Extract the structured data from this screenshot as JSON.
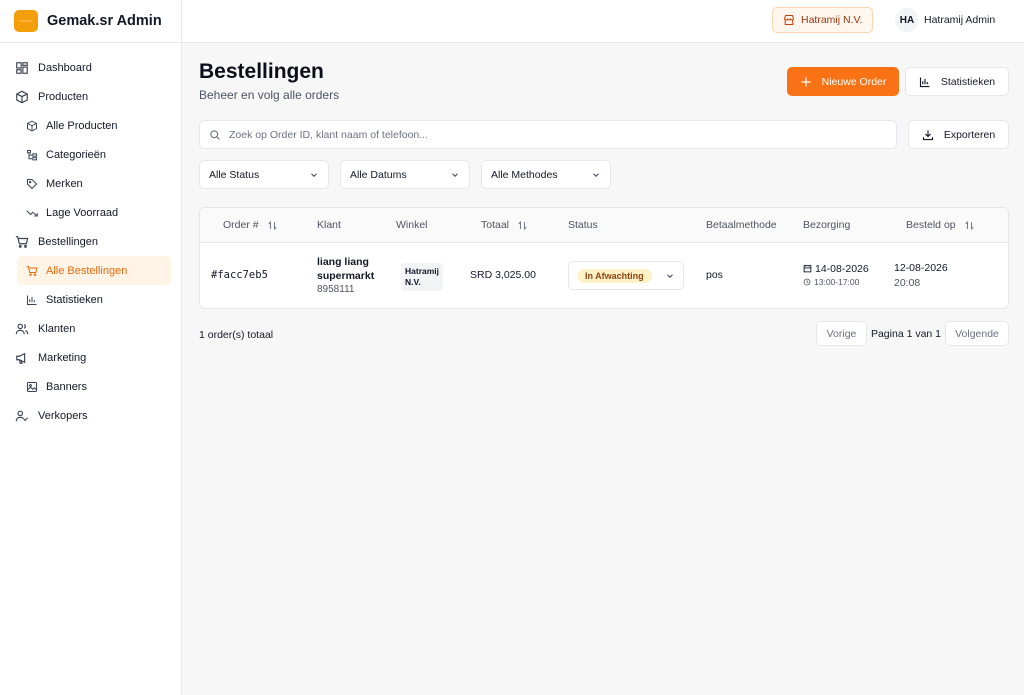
{
  "app": {
    "title": "Gemak.sr Admin"
  },
  "sidebar": {
    "items": [
      {
        "label": "Dashboard",
        "icon": "dashboard-icon"
      },
      {
        "label": "Producten",
        "icon": "box-icon"
      },
      {
        "label": "Alle Producten",
        "icon": "box-icon"
      },
      {
        "label": "Categorieën",
        "icon": "tree-icon"
      },
      {
        "label": "Merken",
        "icon": "tag-icon"
      },
      {
        "label": "Lage Voorraad",
        "icon": "trend-down-icon"
      },
      {
        "label": "Bestellingen",
        "icon": "cart-icon"
      },
      {
        "label": "Alle Bestellingen",
        "icon": "cart-icon"
      },
      {
        "label": "Statistieken",
        "icon": "bar-chart-icon"
      },
      {
        "label": "Klanten",
        "icon": "users-icon"
      },
      {
        "label": "Marketing",
        "icon": "megaphone-icon"
      },
      {
        "label": "Banners",
        "icon": "image-icon"
      },
      {
        "label": "Verkopers",
        "icon": "user-check-icon"
      }
    ]
  },
  "topbar": {
    "store": "Hatramij N.V.",
    "user_initials": "HA",
    "user_name": "Hatramij Admin"
  },
  "page": {
    "title": "Bestellingen",
    "subtitle": "Beheer en volg alle orders",
    "new_order": "Nieuwe Order",
    "stats": "Statistieken",
    "export": "Exporteren",
    "search_placeholder": "Zoek op Order ID, klant naam of telefoon..."
  },
  "filters": {
    "status": "Alle Status",
    "dates": "Alle Datums",
    "methods": "Alle Methodes"
  },
  "table": {
    "columns": [
      "Order #",
      "Klant",
      "Winkel",
      "Totaal",
      "Status",
      "Betaalmethode",
      "Bezorging",
      "Besteld op"
    ],
    "rows": [
      {
        "order": "#facc7eb5",
        "klant": "liang liang supermarkt",
        "phone": "8958111",
        "winkel": "Hatramij N.V.",
        "totaal": "SRD 3,025.00",
        "status": "In Afwachting",
        "methode": "pos",
        "bezorg_date": "14-08-2026",
        "bezorg_time": "13:00-17:00",
        "besteld_date": "12-08-2026",
        "besteld_time": "20:08"
      }
    ]
  },
  "footer": {
    "total": "1 order(s) totaal",
    "prev": "Vorige",
    "page": "Pagina 1 van 1",
    "next": "Volgende"
  },
  "colors": {
    "accent": "#f97316",
    "active_bg": "#fff4e6",
    "status_bg": "#fef3c7"
  }
}
